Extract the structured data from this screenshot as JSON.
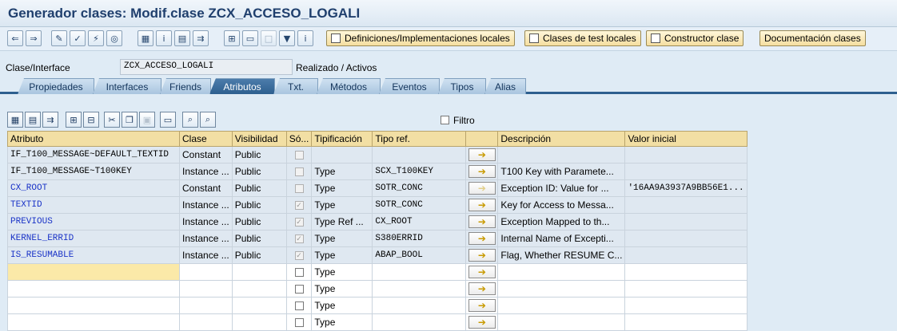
{
  "window": {
    "title": "Generador clases: Modif.clase ZCX_ACCESO_LOGALI"
  },
  "toolbar": {
    "buttons": {
      "definitions": "Definiciones/Implementaciones locales",
      "test_classes": "Clases de test locales",
      "constructor": "Constructor clase",
      "documentation": "Documentación clases"
    }
  },
  "header": {
    "class_label": "Clase/Interface",
    "class_value": "ZCX_ACCESO_LOGALI",
    "status": "Realizado / Activos"
  },
  "tabs": [
    "Propiedades",
    "Interfaces",
    "Friends",
    "Atributos",
    "Txt.",
    "Métodos",
    "Eventos",
    "Tipos",
    "Alias"
  ],
  "active_tab": "Atributos",
  "filter_label": "Filtro",
  "grid": {
    "columns": [
      "Atributo",
      "Clase",
      "Visibilidad",
      "Só...",
      "Tipificación",
      "Tipo ref.",
      "",
      "Descripción",
      "Valor inicial"
    ],
    "rows": [
      {
        "attr": "IF_T100_MESSAGE~DEFAULT_TEXTID",
        "clase": "Constant",
        "vis": "Public",
        "ro": false,
        "tip": "",
        "ref": "",
        "desc": "",
        "val": "",
        "inherited": true
      },
      {
        "attr": "IF_T100_MESSAGE~T100KEY",
        "clase": "Instance ...",
        "vis": "Public",
        "ro": false,
        "tip": "Type",
        "ref": "SCX_T100KEY",
        "desc": "T100 Key with Paramete...",
        "val": "",
        "inherited": true
      },
      {
        "attr": "CX_ROOT",
        "clase": "Constant",
        "vis": "Public",
        "ro": false,
        "tip": "Type",
        "ref": "SOTR_CONC",
        "desc": "Exception ID: Value for ...",
        "val": "'16AA9A3937A9BB56E1...",
        "inherited": false
      },
      {
        "attr": "TEXTID",
        "clase": "Instance ...",
        "vis": "Public",
        "ro": true,
        "tip": "Type",
        "ref": "SOTR_CONC",
        "desc": "Key for Access to Messa...",
        "val": "",
        "inherited": false
      },
      {
        "attr": "PREVIOUS",
        "clase": "Instance ...",
        "vis": "Public",
        "ro": true,
        "tip": "Type Ref ...",
        "ref": "CX_ROOT",
        "desc": "Exception Mapped to th...",
        "val": "",
        "inherited": false
      },
      {
        "attr": "KERNEL_ERRID",
        "clase": "Instance ...",
        "vis": "Public",
        "ro": true,
        "tip": "Type",
        "ref": "S380ERRID",
        "desc": "Internal Name of Excepti...",
        "val": "",
        "inherited": false
      },
      {
        "attr": "IS_RESUMABLE",
        "clase": "Instance ...",
        "vis": "Public",
        "ro": true,
        "tip": "Type",
        "ref": "ABAP_BOOL",
        "desc": "Flag, Whether RESUME C...",
        "val": "",
        "inherited": false
      },
      {
        "attr": "",
        "clase": "",
        "vis": "",
        "ro": false,
        "tip": "Type",
        "ref": "",
        "desc": "",
        "val": "",
        "inherited": false,
        "edit": true
      },
      {
        "attr": "",
        "clase": "",
        "vis": "",
        "ro": false,
        "tip": "Type",
        "ref": "",
        "desc": "",
        "val": "",
        "inherited": false,
        "edit": true
      },
      {
        "attr": "",
        "clase": "",
        "vis": "",
        "ro": false,
        "tip": "Type",
        "ref": "",
        "desc": "",
        "val": "",
        "inherited": false,
        "edit": true
      },
      {
        "attr": "",
        "clase": "",
        "vis": "",
        "ro": false,
        "tip": "Type",
        "ref": "",
        "desc": "",
        "val": "",
        "inherited": false,
        "edit": true
      }
    ]
  }
}
